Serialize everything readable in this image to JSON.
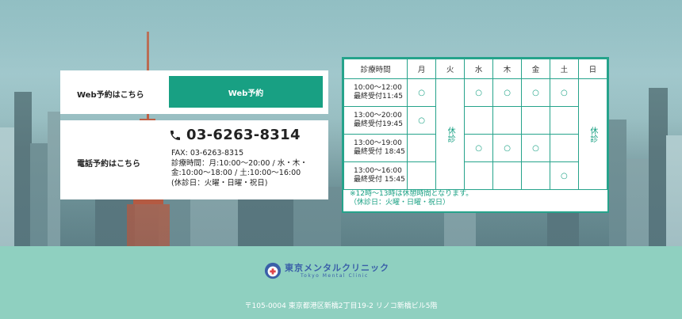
{
  "reservation": {
    "web_label": "Web予約はこちら",
    "web_button": "Web予約",
    "tel_label": "電話予約はこちら",
    "tel_number": "03-6263-8314",
    "fax": "FAX: 03-6263-8315",
    "hours_line1": "診療時間：月:10:00～20:00 / 水・木・",
    "hours_line2": "金:10:00～18:00 / 土:10:00～16:00",
    "closed_days": "(休診日：火曜・日曜・祝日)"
  },
  "schedule": {
    "header": [
      "診療時間",
      "月",
      "火",
      "水",
      "木",
      "金",
      "土",
      "日"
    ],
    "rows": [
      {
        "time": "10:00～12:00",
        "sub": "最終受付11:45",
        "marks": [
          "○",
          "",
          "○",
          "○",
          "○",
          "○",
          ""
        ]
      },
      {
        "time": "13:00～20:00",
        "sub": "最終受付19:45",
        "marks": [
          "○",
          "",
          "",
          "",
          "",
          "",
          ""
        ]
      },
      {
        "time": "13:00～19:00",
        "sub": "最終受付 18:45",
        "marks": [
          "",
          "",
          "○",
          "○",
          "○",
          "",
          ""
        ]
      },
      {
        "time": "13:00～16:00",
        "sub": "最終受付 15:45",
        "marks": [
          "",
          "",
          "",
          "",
          "",
          "○",
          ""
        ]
      }
    ],
    "closed_label": "休診",
    "note_line1": "※12時～13時は休憩時間となります。",
    "note_line2": "（休診日：火曜・日曜・祝日）"
  },
  "footer": {
    "logo_jp": "東京メンタルクリニック",
    "logo_en": "Tokyo Mental Clinic",
    "address": "〒105-0004 東京都港区新橋2丁目19-2 リノコ新橋ビル5階"
  },
  "colors": {
    "accent": "#18a083",
    "table_border": "#26a38b",
    "footer_bg": "#8fd0c0",
    "logo": "#3a5fa8"
  }
}
